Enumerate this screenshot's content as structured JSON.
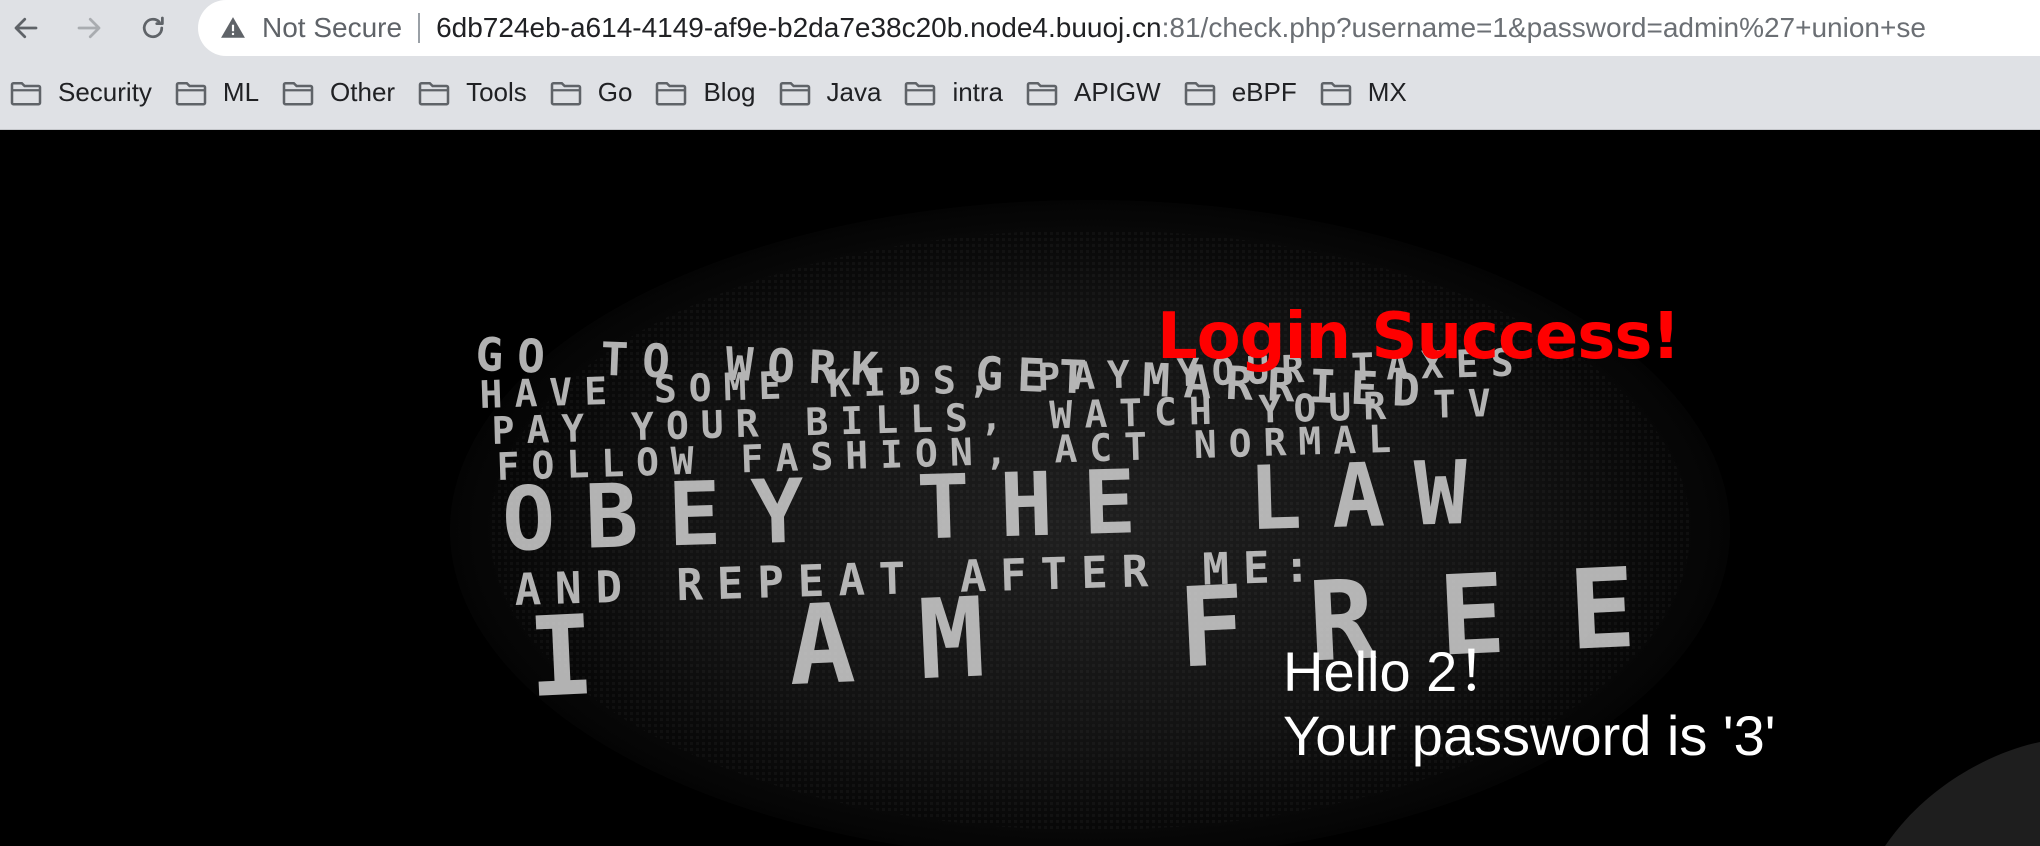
{
  "browser": {
    "security_label": "Not Secure",
    "url_host": "6db724eb-a614-4149-af9e-b2da7e38c20b.node4.buuoj.cn",
    "url_rest": ":81/check.php?username=1&password=admin%27+union+se",
    "icons": {
      "back": "arrow-left-icon",
      "forward": "arrow-right-icon",
      "reload": "reload-icon",
      "security": "warning-triangle-icon",
      "bookmark": "folder-icon"
    }
  },
  "bookmarks": [
    {
      "label": "Security"
    },
    {
      "label": "ML"
    },
    {
      "label": "Other"
    },
    {
      "label": "Tools"
    },
    {
      "label": "Go"
    },
    {
      "label": "Blog"
    },
    {
      "label": "Java"
    },
    {
      "label": "intra"
    },
    {
      "label": "APIGW"
    },
    {
      "label": "eBPF"
    },
    {
      "label": "MX"
    }
  ],
  "page": {
    "poster_lines": [
      "GO TO WORK, GET MARRIED",
      "HAVE SOME KIDS, PAY YOUR TAXES",
      "PAY YOUR BILLS, WATCH YOUR TV",
      "FOLLOW FASHION, ACT NORMAL",
      "OBEY THE LAW",
      "AND REPEAT AFTER ME:",
      "I AM FREE"
    ],
    "login_message": "Login Success!",
    "greeting_line1": "Hello 2！",
    "greeting_line2": "Your password is '3'",
    "colors": {
      "login_message": "#ff0000",
      "background": "#000000",
      "text": "#ffffff"
    }
  }
}
